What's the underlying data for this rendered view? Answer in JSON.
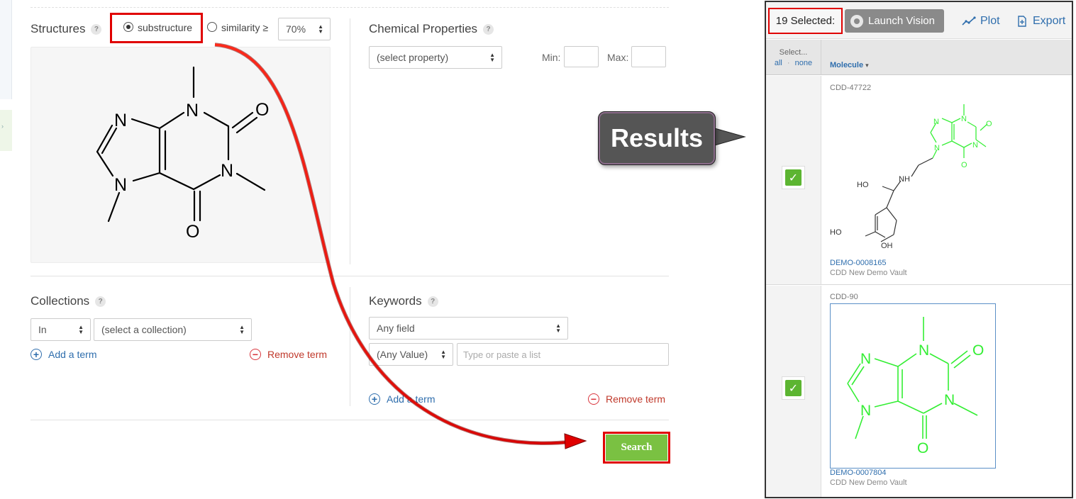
{
  "search_form": {
    "structures": {
      "title": "Structures",
      "help": "?",
      "mode_substructure": "substructure",
      "mode_similarity": "similarity ≥",
      "similarity_value": "70%",
      "selected_mode": "substructure",
      "molecule_atoms": [
        "N",
        "N",
        "N",
        "N",
        "O",
        "O"
      ]
    },
    "chemical_properties": {
      "title": "Chemical Properties",
      "help": "?",
      "property_select": "(select property)",
      "min_label": "Min:",
      "max_label": "Max:",
      "min_value": "",
      "max_value": ""
    },
    "collections": {
      "title": "Collections",
      "help": "?",
      "operator": "In",
      "collection_select": "(select a collection)",
      "add_term": "Add a term",
      "remove_term": "Remove term"
    },
    "keywords": {
      "title": "Keywords",
      "help": "?",
      "field_select": "Any field",
      "value_select": "(Any Value)",
      "list_placeholder": "Type or paste a list",
      "add_term": "Add a term",
      "remove_term": "Remove term"
    },
    "search_button": "Search"
  },
  "callout": {
    "label": "Results"
  },
  "results": {
    "toolbar": {
      "selected_count": "19 Selected:",
      "launch_vision": "Launch Vision",
      "plot": "Plot",
      "export": "Export"
    },
    "header": {
      "select_label": "Select...",
      "all": "all",
      "none": "none",
      "separator": "·",
      "molecule_col": "Molecule"
    },
    "rows": [
      {
        "cdd_id": "CDD-47722",
        "demo_id": "DEMO-0008165",
        "vault": "CDD New Demo Vault",
        "checked": true,
        "atoms": [
          "N",
          "N",
          "N",
          "N",
          "O",
          "O",
          "NH",
          "HO",
          "HO",
          "OH"
        ]
      },
      {
        "cdd_id": "CDD-90",
        "demo_id": "DEMO-0007804",
        "vault": "CDD New Demo Vault",
        "checked": true,
        "atoms": [
          "N",
          "N",
          "N",
          "N",
          "O",
          "O"
        ]
      }
    ]
  },
  "colors": {
    "highlight_red": "#e00000",
    "search_green": "#7ac142",
    "molecule_green": "#33ee33",
    "link_blue": "#2f6ead",
    "remove_red": "#d9363e",
    "check_green": "#5cb531"
  },
  "icons": [
    "help-icon",
    "radio-icon",
    "updown-arrows-icon",
    "plus-circle-icon",
    "minus-circle-icon",
    "vision-icon",
    "plot-icon",
    "export-icon",
    "sort-icon",
    "checkmark-icon"
  ]
}
